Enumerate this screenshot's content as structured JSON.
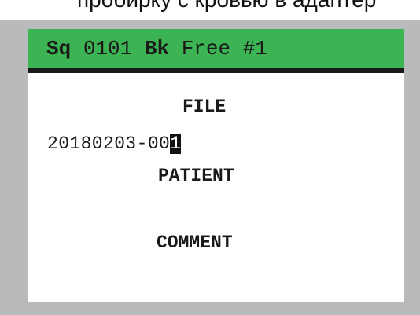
{
  "caption": "пробирку с кровью в адаптер",
  "status_bar": {
    "sq_label": "Sq",
    "sq_value": "0101",
    "bk_label": "Bk",
    "bk_value": "Free #1",
    "color": "#3db454"
  },
  "form": {
    "file_label": "FILE",
    "file_value_text": "20180203-00",
    "file_value_cursor_char": "1",
    "patient_label": "PATIENT",
    "comment_label": "COMMENT"
  },
  "colors": {
    "frame": "#b9babc",
    "screen": "#ffffff",
    "text": "#1a1a1a",
    "cursor": "#111111"
  }
}
